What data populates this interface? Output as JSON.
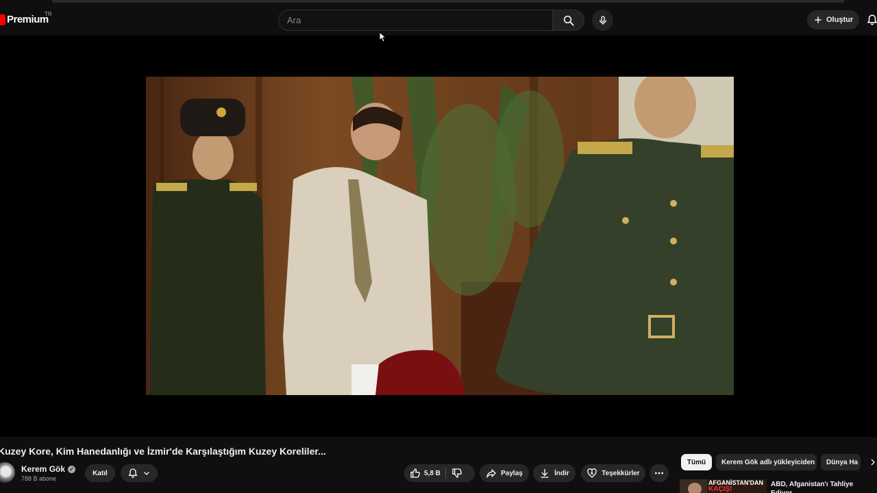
{
  "header": {
    "logo_text": "Premium",
    "logo_region": "TR",
    "search_placeholder": "Ara",
    "create_label": "Oluştur"
  },
  "video": {
    "title": "Kuzey Kore, Kim Hanedanlığı ve İzmir'de Karşılaştığım Kuzey Koreliler..."
  },
  "channel": {
    "name": "Kerem Gök",
    "subscribers": "788 B abone",
    "join_label": "Katıl"
  },
  "actions": {
    "like_count": "5,8 B",
    "share_label": "Paylaş",
    "download_label": "İndir",
    "thanks_label": "Teşekkürler"
  },
  "chips": [
    {
      "label": "Tümü"
    },
    {
      "label": "Kerem Gök adlı yükleyiciden"
    },
    {
      "label": "Dünya Ha"
    }
  ],
  "recommendation": {
    "thumb_line1": "AFGANİSTAN'DAN",
    "thumb_line2": "KAÇIŞ!",
    "title": "ABD, Afganistan'ı Tahliye Ediyor"
  }
}
